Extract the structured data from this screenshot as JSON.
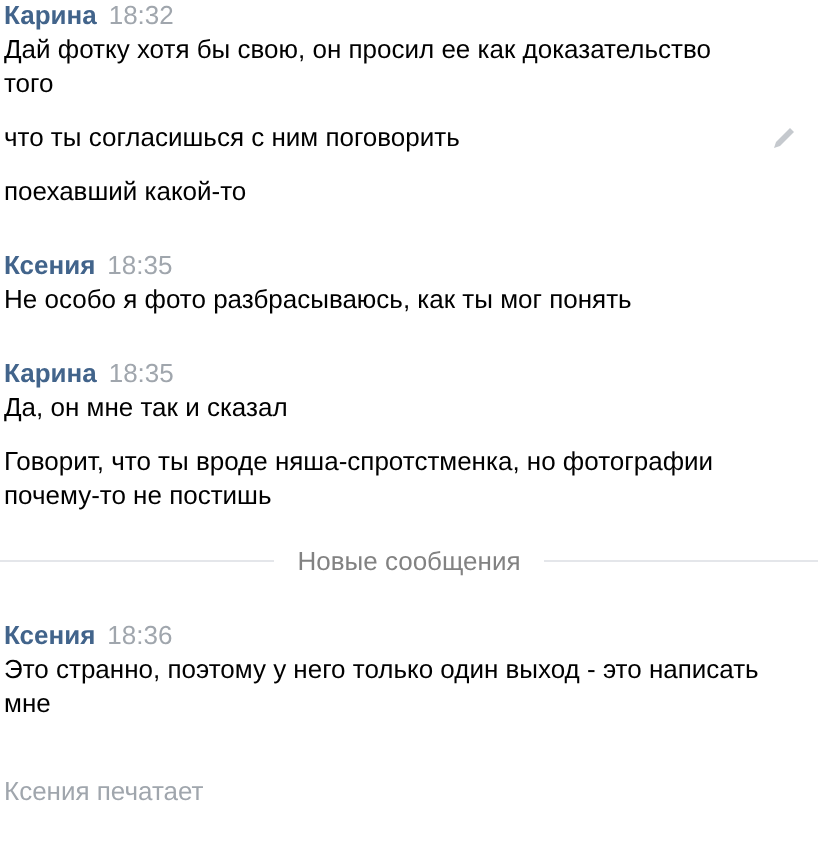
{
  "groups": [
    {
      "author": "Карина",
      "time": "18:32",
      "messages": [
        {
          "text": "Дай фотку хотя бы свою, он просил ее как доказательство того",
          "editable": false
        },
        {
          "text": "что ты согласишься с ним поговорить",
          "editable": true
        },
        {
          "text": "поехавший какой-то",
          "editable": false
        }
      ]
    },
    {
      "author": "Ксения",
      "time": "18:35",
      "messages": [
        {
          "text": "Не особо я фото разбрасываюсь, как ты мог понять",
          "editable": false
        }
      ]
    },
    {
      "author": "Карина",
      "time": "18:35",
      "messages": [
        {
          "text": "Да, он мне так и сказал",
          "editable": false
        },
        {
          "text": "Говорит, что ты вроде няша-спротстменка, но фотографии почему-то не постишь",
          "editable": false
        }
      ]
    },
    {
      "kind": "divider",
      "label": "Новые сообщения"
    },
    {
      "author": "Ксения",
      "time": "18:36",
      "messages": [
        {
          "text": "Это странно, поэтому у него только один выход - это написать мне",
          "editable": false
        }
      ]
    }
  ],
  "typing": "Ксения печатает"
}
